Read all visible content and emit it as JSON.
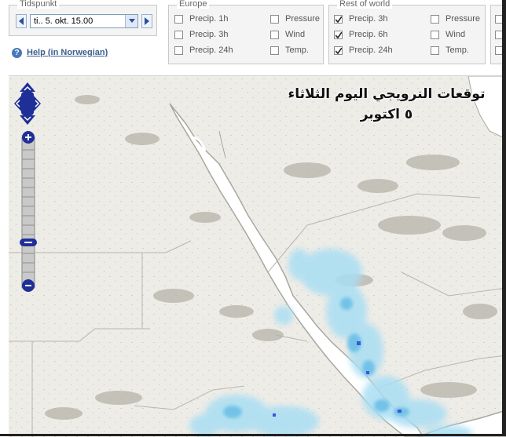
{
  "time": {
    "legend": "Tidspunkt",
    "selected": "ti.. 5. okt. 15.00"
  },
  "help": {
    "icon": "?",
    "label": "Help (in Norwegian)"
  },
  "europe": {
    "legend": "Europe",
    "options": [
      {
        "label": "Precip. 1h",
        "checked": false
      },
      {
        "label": "Pressure",
        "checked": false
      },
      {
        "label": "Precip. 3h",
        "checked": false
      },
      {
        "label": "Wind",
        "checked": false
      },
      {
        "label": "Precip. 24h",
        "checked": false
      },
      {
        "label": "Temp.",
        "checked": false
      }
    ]
  },
  "world": {
    "legend": "Rest of world",
    "options": [
      {
        "label": "Precip. 3h",
        "checked": true
      },
      {
        "label": "Pressure",
        "checked": false
      },
      {
        "label": "Precip. 6h",
        "checked": true
      },
      {
        "label": "Wind",
        "checked": false
      },
      {
        "label": "Precip. 24h",
        "checked": true
      },
      {
        "label": "Temp.",
        "checked": false
      }
    ]
  },
  "map": {
    "caption_line1": "توقعات النرويجي اليوم الثلاثاء",
    "caption_line2": "٥ اكتوبر",
    "land_color": "#eeece7",
    "sea_color": "#ffffff",
    "precip_color": "#8fd3f0",
    "heavy_precip_color": "#3f55d8"
  },
  "colors": {
    "accent": "#2a3f8f",
    "checkbox_check": "#222222"
  }
}
